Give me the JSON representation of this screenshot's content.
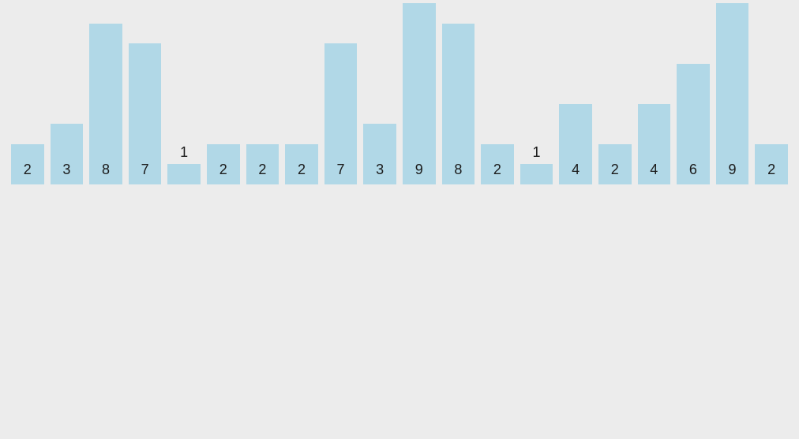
{
  "chart_data": {
    "type": "bar",
    "values": [
      2,
      3,
      8,
      7,
      1,
      2,
      2,
      2,
      7,
      3,
      9,
      8,
      2,
      1,
      4,
      2,
      4,
      6,
      9,
      2
    ],
    "ylim": [
      0,
      9
    ],
    "bar_color": "#b1d8e7",
    "background_color": "#ececec",
    "label_threshold": 2
  }
}
